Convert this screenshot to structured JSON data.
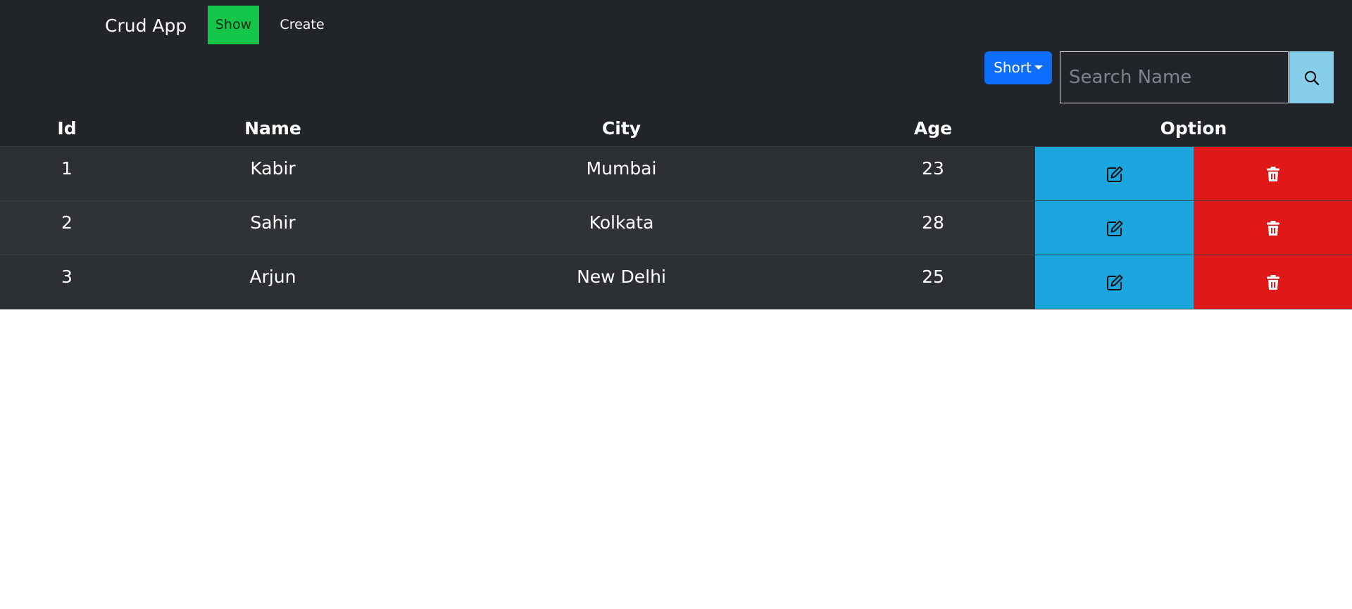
{
  "navbar": {
    "brand": "Crud App",
    "show_label": "Show",
    "create_label": "Create"
  },
  "toolbar": {
    "sort_label": "Short",
    "search_placeholder": "Search Name",
    "search_value": ""
  },
  "table": {
    "columns": [
      "Id",
      "Name",
      "City",
      "Age",
      "Option"
    ],
    "rows": [
      {
        "id": "1",
        "name": "Kabir",
        "city": "Mumbai",
        "age": "23"
      },
      {
        "id": "2",
        "name": "Sahir",
        "city": "Kolkata",
        "age": "28"
      },
      {
        "id": "3",
        "name": "Arjun",
        "city": "New Delhi",
        "age": "25"
      }
    ]
  },
  "icons": {
    "edit": "edit-icon",
    "delete": "trash-icon",
    "search": "search-icon",
    "sort_caret": "caret-down-icon"
  },
  "colors": {
    "background": "#212529",
    "show_button": "#14c64a",
    "sort_button": "#0d6efd",
    "search_button": "#87ceeb",
    "edit_button": "#1ba6df",
    "delete_button": "#e01818"
  }
}
